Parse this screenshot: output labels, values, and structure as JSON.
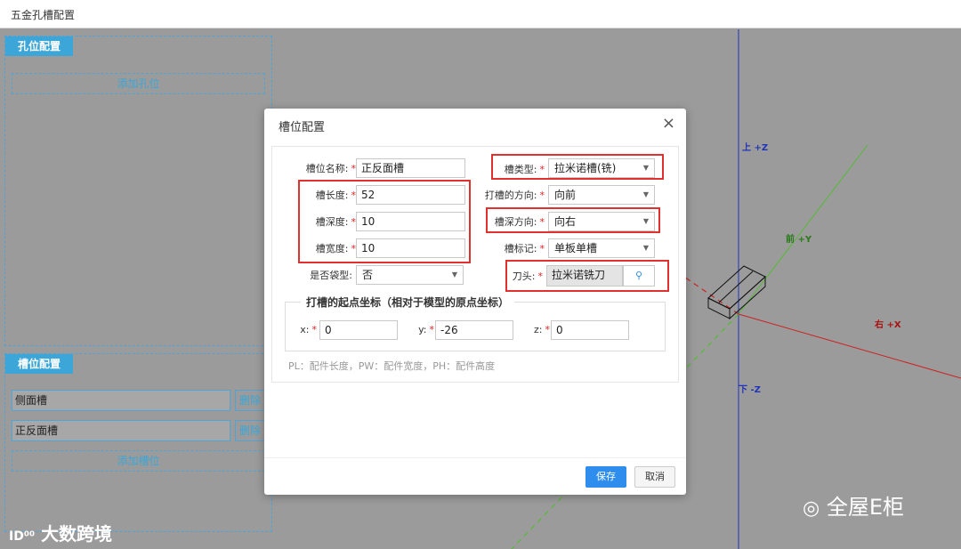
{
  "app": {
    "title": "五金孔槽配置"
  },
  "hole_panel": {
    "tag": "孔位配置",
    "add_label": "添加孔位"
  },
  "slot_panel": {
    "tag": "槽位配置",
    "slots": [
      {
        "name": "侧面槽",
        "delete_label": "删除"
      },
      {
        "name": "正反面槽",
        "delete_label": "删除"
      }
    ],
    "add_label": "添加槽位"
  },
  "axes": {
    "up": "上 +Z",
    "down": "下 -Z",
    "front": "前 +Y",
    "right": "右 +X"
  },
  "dialog": {
    "title": "槽位配置",
    "close": "×",
    "fields": {
      "slot_name": {
        "label": "槽位名称:",
        "value": "正反面槽"
      },
      "slot_length": {
        "label": "槽长度:",
        "value": "52"
      },
      "slot_depth": {
        "label": "槽深度:",
        "value": "10"
      },
      "slot_width": {
        "label": "槽宽度:",
        "value": "10"
      },
      "pocket": {
        "label": "是否袋型:",
        "value": "否"
      },
      "slot_type": {
        "label": "槽类型:",
        "value": "拉米诺槽(铣)"
      },
      "slot_direction": {
        "label": "打槽的方向:",
        "value": "向前"
      },
      "depth_direction": {
        "label": "槽深方向:",
        "value": "向右"
      },
      "slot_mark": {
        "label": "槽标记:",
        "value": "单板单槽"
      },
      "cutter": {
        "label": "刀头:",
        "value": "拉米诺铣刀"
      }
    },
    "origin": {
      "legend": "打槽的起点坐标（相对于模型的原点坐标）",
      "x": {
        "label": "x:",
        "value": "0"
      },
      "y": {
        "label": "y:",
        "value": "-26"
      },
      "z": {
        "label": "z:",
        "value": "0"
      }
    },
    "hint": "PL：配件长度，PW：配件宽度，PH：配件高度",
    "save_label": "保存",
    "cancel_label": "取消"
  },
  "watermarks": {
    "left": "大数跨境",
    "right": "全屋E柜"
  },
  "colors": {
    "accent": "#3ba6d7",
    "highlight": "#e03030",
    "primary_button": "#2e8ded"
  }
}
